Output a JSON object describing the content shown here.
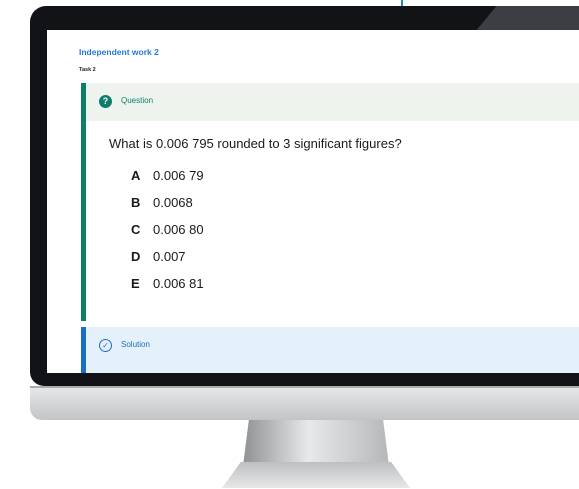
{
  "page": {
    "heading": "Independent work 2",
    "task_label": "Task 2"
  },
  "question": {
    "header_label": "Question",
    "icon": "question-circle-icon",
    "text": "What is 0.006 795 rounded to 3 significant figures?",
    "options": [
      {
        "letter": "A",
        "value": "0.006 79"
      },
      {
        "letter": "B",
        "value": "0.0068"
      },
      {
        "letter": "C",
        "value": "0.006 80"
      },
      {
        "letter": "D",
        "value": "0.007"
      },
      {
        "letter": "E",
        "value": "0.006 81"
      }
    ]
  },
  "solution": {
    "header_label": "Solution",
    "icon": "check-circle-icon"
  },
  "colors": {
    "heading": "#2878d2",
    "question_accent": "#0e7e6b",
    "question_header_bg": "#eef3ee",
    "solution_accent": "#1b6fc2",
    "solution_bg": "#e4f0fa",
    "bezel": "#121316"
  }
}
